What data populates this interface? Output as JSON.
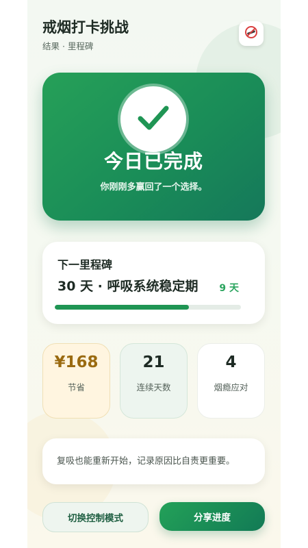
{
  "header": {
    "title": "戒烟打卡挑战",
    "subtitle": "结果 · 里程碑",
    "icon": "no-smoking-icon"
  },
  "hero": {
    "icon": "checkmark-icon",
    "title": "今日已完成",
    "subtitle": "你刚刚多赢回了一个选择。"
  },
  "milestone": {
    "label": "下一里程碑",
    "name": "30 天 · 呼吸系统稳定期",
    "days_left": "9 天",
    "progress": 0.72
  },
  "stats": [
    {
      "value": "¥168",
      "label": "节省"
    },
    {
      "value": "21",
      "label": "连续天数"
    },
    {
      "value": "4",
      "label": "烟瘾应对"
    }
  ],
  "note": {
    "text": "复吸也能重新开始，记录原因比自责更重要。"
  },
  "actions": {
    "switch_label": "切换控制模式",
    "share_label": "分享进度"
  },
  "colors": {
    "accent": "#1f9554",
    "hero_start": "#26a058",
    "hero_end": "#15785a",
    "savings": "#9a6a10"
  }
}
